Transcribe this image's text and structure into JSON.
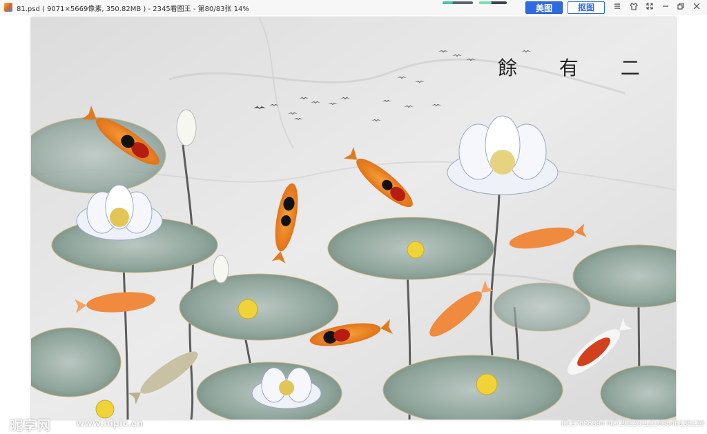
{
  "titlebar": {
    "title": "81.psd ( 9071×5669像素, 350.82MB ) - 2345看图王 - 第80/83张 14%",
    "beautify_label": "美图",
    "cutout_label": "抠图",
    "load_progress": 0.35
  },
  "icons": {
    "menu": "menu-icon",
    "skin": "skin-icon",
    "fullscreen": "fullscreen-icon",
    "minimize": "minimize-icon",
    "restore": "restore-icon",
    "close": "close-icon"
  },
  "artwork": {
    "calligraphy": "餘 有 二 月"
  },
  "watermark": {
    "logo": "昵享网",
    "url": "www.nipic.cn",
    "id": "ID:27656394 NO:20220110160546135120"
  }
}
